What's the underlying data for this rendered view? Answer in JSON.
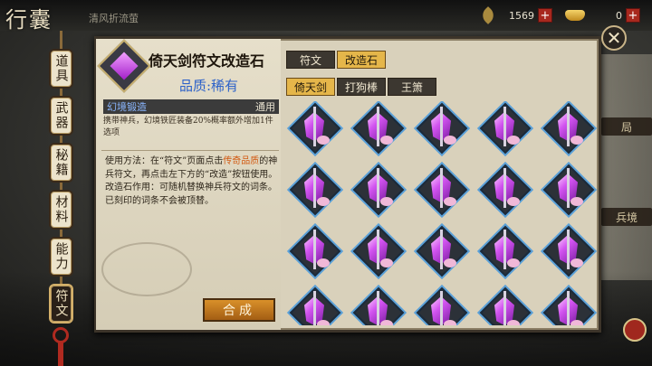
{
  "header": {
    "title": "行囊",
    "subtitle": "清风折流萤",
    "currency": {
      "primary_value": "1569",
      "secondary_value": "0"
    }
  },
  "sidebar": {
    "items": [
      {
        "label": "道具",
        "active": false
      },
      {
        "label": "武器",
        "active": false
      },
      {
        "label": "秘籍",
        "active": false
      },
      {
        "label": "材料",
        "active": false
      },
      {
        "label": "能力",
        "active": false
      },
      {
        "label": "符文",
        "active": true
      }
    ]
  },
  "background": {
    "sign1": "局",
    "sign2": "兵境"
  },
  "detail": {
    "item_name": "倚天剑符文改造石",
    "quality": "品质:稀有",
    "effect_name": "幻境锻造",
    "effect_tag": "通用",
    "effect_desc": "携带神兵，幻境铁匠装备20%概率额外增加1件选项",
    "usage_prefix": "使用方法：在“符文”页面点击",
    "usage_highlight": "传奇品质",
    "usage_suffix": "的神兵符文，再点击左下方的“改造”按钮使用。",
    "usage2": "改造石作用：可随机替换神兵符文的词条。已刻印的词条不会被顶替。",
    "merge_button": "合成"
  },
  "tabs": {
    "type_tabs": [
      {
        "label": "符文",
        "active": false
      },
      {
        "label": "改造石",
        "active": true
      }
    ],
    "weapon_tabs": [
      {
        "label": "倚天剑",
        "active": true
      },
      {
        "label": "打狗棒",
        "active": false
      },
      {
        "label": "王箫",
        "active": false
      }
    ]
  },
  "grid": {
    "rows": 4,
    "cols": 5,
    "item": "倚天剑符文改造石"
  },
  "colors": {
    "accent": "#e5b64a",
    "quality": "#2d62c9",
    "highlight": "#d25a12",
    "panel": "#d9d1bb"
  }
}
